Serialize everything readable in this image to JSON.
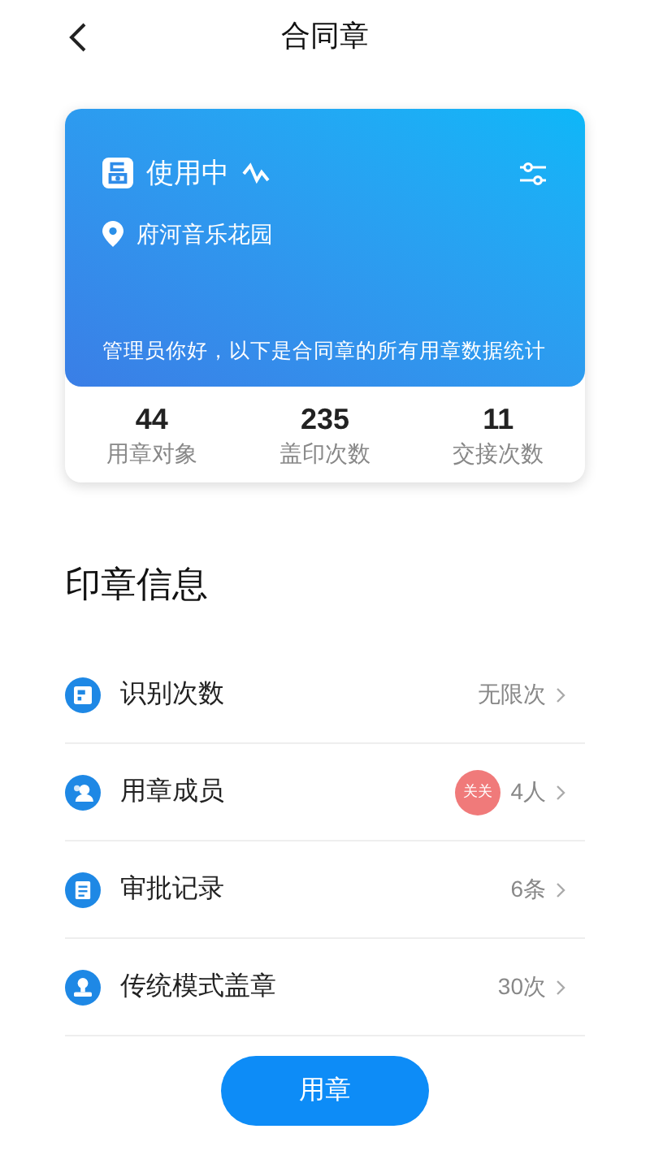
{
  "header": {
    "title": "合同章"
  },
  "card": {
    "status": "使用中",
    "location": "府河音乐花园",
    "greeting": "管理员你好，以下是合同章的所有用章数据统计",
    "stats": [
      {
        "value": "44",
        "label": "用章对象"
      },
      {
        "value": "235",
        "label": "盖印次数"
      },
      {
        "value": "11",
        "label": "交接次数"
      }
    ]
  },
  "section_title": "印章信息",
  "rows": [
    {
      "label": "识别次数",
      "value": "无限次"
    },
    {
      "label": "用章成员",
      "value": "4人",
      "avatar": "关关"
    },
    {
      "label": "审批记录",
      "value": "6条"
    },
    {
      "label": "传统模式盖章",
      "value": "30次"
    }
  ],
  "primary_button": "用章"
}
